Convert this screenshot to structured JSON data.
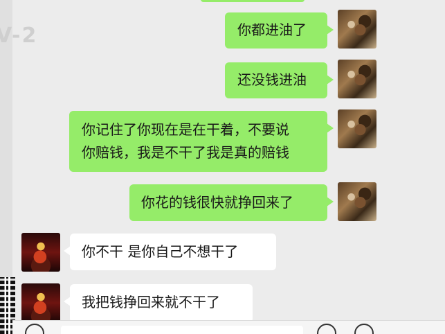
{
  "watermark": "V-2",
  "messages": [
    {
      "side": "me",
      "lines": [
        "你都进油了"
      ]
    },
    {
      "side": "me",
      "lines": [
        "还没钱进油"
      ]
    },
    {
      "side": "me",
      "lines": [
        "你记住了你现在是在干着，不要说",
        "你赔钱，我是不干了我是真的赔钱"
      ]
    },
    {
      "side": "me",
      "lines": [
        "你花的钱很快就挣回来了"
      ]
    },
    {
      "side": "other",
      "lines": [
        "你不干 是你自己不想干了"
      ]
    },
    {
      "side": "other",
      "lines": [
        "我把钱挣回来就不干了"
      ]
    }
  ],
  "colors": {
    "my_bubble": "#95ec69",
    "their_bubble": "#ffffff",
    "background": "#ececec"
  },
  "icons": {
    "voice": "voice-icon",
    "emoji": "emoji-icon",
    "more": "plus-icon"
  }
}
